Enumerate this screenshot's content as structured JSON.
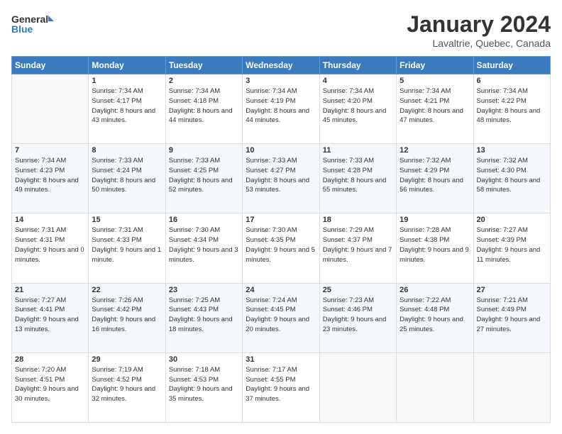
{
  "header": {
    "logo_line1": "General",
    "logo_line2": "Blue",
    "title": "January 2024",
    "subtitle": "Lavaltrie, Quebec, Canada"
  },
  "days_of_week": [
    "Sunday",
    "Monday",
    "Tuesday",
    "Wednesday",
    "Thursday",
    "Friday",
    "Saturday"
  ],
  "weeks": [
    [
      {
        "day": "",
        "sunrise": "",
        "sunset": "",
        "daylight": ""
      },
      {
        "day": "1",
        "sunrise": "Sunrise: 7:34 AM",
        "sunset": "Sunset: 4:17 PM",
        "daylight": "Daylight: 8 hours and 43 minutes."
      },
      {
        "day": "2",
        "sunrise": "Sunrise: 7:34 AM",
        "sunset": "Sunset: 4:18 PM",
        "daylight": "Daylight: 8 hours and 44 minutes."
      },
      {
        "day": "3",
        "sunrise": "Sunrise: 7:34 AM",
        "sunset": "Sunset: 4:19 PM",
        "daylight": "Daylight: 8 hours and 44 minutes."
      },
      {
        "day": "4",
        "sunrise": "Sunrise: 7:34 AM",
        "sunset": "Sunset: 4:20 PM",
        "daylight": "Daylight: 8 hours and 45 minutes."
      },
      {
        "day": "5",
        "sunrise": "Sunrise: 7:34 AM",
        "sunset": "Sunset: 4:21 PM",
        "daylight": "Daylight: 8 hours and 47 minutes."
      },
      {
        "day": "6",
        "sunrise": "Sunrise: 7:34 AM",
        "sunset": "Sunset: 4:22 PM",
        "daylight": "Daylight: 8 hours and 48 minutes."
      }
    ],
    [
      {
        "day": "7",
        "sunrise": "Sunrise: 7:34 AM",
        "sunset": "Sunset: 4:23 PM",
        "daylight": "Daylight: 8 hours and 49 minutes."
      },
      {
        "day": "8",
        "sunrise": "Sunrise: 7:33 AM",
        "sunset": "Sunset: 4:24 PM",
        "daylight": "Daylight: 8 hours and 50 minutes."
      },
      {
        "day": "9",
        "sunrise": "Sunrise: 7:33 AM",
        "sunset": "Sunset: 4:25 PM",
        "daylight": "Daylight: 8 hours and 52 minutes."
      },
      {
        "day": "10",
        "sunrise": "Sunrise: 7:33 AM",
        "sunset": "Sunset: 4:27 PM",
        "daylight": "Daylight: 8 hours and 53 minutes."
      },
      {
        "day": "11",
        "sunrise": "Sunrise: 7:33 AM",
        "sunset": "Sunset: 4:28 PM",
        "daylight": "Daylight: 8 hours and 55 minutes."
      },
      {
        "day": "12",
        "sunrise": "Sunrise: 7:32 AM",
        "sunset": "Sunset: 4:29 PM",
        "daylight": "Daylight: 8 hours and 56 minutes."
      },
      {
        "day": "13",
        "sunrise": "Sunrise: 7:32 AM",
        "sunset": "Sunset: 4:30 PM",
        "daylight": "Daylight: 8 hours and 58 minutes."
      }
    ],
    [
      {
        "day": "14",
        "sunrise": "Sunrise: 7:31 AM",
        "sunset": "Sunset: 4:31 PM",
        "daylight": "Daylight: 9 hours and 0 minutes."
      },
      {
        "day": "15",
        "sunrise": "Sunrise: 7:31 AM",
        "sunset": "Sunset: 4:33 PM",
        "daylight": "Daylight: 9 hours and 1 minute."
      },
      {
        "day": "16",
        "sunrise": "Sunrise: 7:30 AM",
        "sunset": "Sunset: 4:34 PM",
        "daylight": "Daylight: 9 hours and 3 minutes."
      },
      {
        "day": "17",
        "sunrise": "Sunrise: 7:30 AM",
        "sunset": "Sunset: 4:35 PM",
        "daylight": "Daylight: 9 hours and 5 minutes."
      },
      {
        "day": "18",
        "sunrise": "Sunrise: 7:29 AM",
        "sunset": "Sunset: 4:37 PM",
        "daylight": "Daylight: 9 hours and 7 minutes."
      },
      {
        "day": "19",
        "sunrise": "Sunrise: 7:28 AM",
        "sunset": "Sunset: 4:38 PM",
        "daylight": "Daylight: 9 hours and 9 minutes."
      },
      {
        "day": "20",
        "sunrise": "Sunrise: 7:27 AM",
        "sunset": "Sunset: 4:39 PM",
        "daylight": "Daylight: 9 hours and 11 minutes."
      }
    ],
    [
      {
        "day": "21",
        "sunrise": "Sunrise: 7:27 AM",
        "sunset": "Sunset: 4:41 PM",
        "daylight": "Daylight: 9 hours and 13 minutes."
      },
      {
        "day": "22",
        "sunrise": "Sunrise: 7:26 AM",
        "sunset": "Sunset: 4:42 PM",
        "daylight": "Daylight: 9 hours and 16 minutes."
      },
      {
        "day": "23",
        "sunrise": "Sunrise: 7:25 AM",
        "sunset": "Sunset: 4:43 PM",
        "daylight": "Daylight: 9 hours and 18 minutes."
      },
      {
        "day": "24",
        "sunrise": "Sunrise: 7:24 AM",
        "sunset": "Sunset: 4:45 PM",
        "daylight": "Daylight: 9 hours and 20 minutes."
      },
      {
        "day": "25",
        "sunrise": "Sunrise: 7:23 AM",
        "sunset": "Sunset: 4:46 PM",
        "daylight": "Daylight: 9 hours and 23 minutes."
      },
      {
        "day": "26",
        "sunrise": "Sunrise: 7:22 AM",
        "sunset": "Sunset: 4:48 PM",
        "daylight": "Daylight: 9 hours and 25 minutes."
      },
      {
        "day": "27",
        "sunrise": "Sunrise: 7:21 AM",
        "sunset": "Sunset: 4:49 PM",
        "daylight": "Daylight: 9 hours and 27 minutes."
      }
    ],
    [
      {
        "day": "28",
        "sunrise": "Sunrise: 7:20 AM",
        "sunset": "Sunset: 4:51 PM",
        "daylight": "Daylight: 9 hours and 30 minutes."
      },
      {
        "day": "29",
        "sunrise": "Sunrise: 7:19 AM",
        "sunset": "Sunset: 4:52 PM",
        "daylight": "Daylight: 9 hours and 32 minutes."
      },
      {
        "day": "30",
        "sunrise": "Sunrise: 7:18 AM",
        "sunset": "Sunset: 4:53 PM",
        "daylight": "Daylight: 9 hours and 35 minutes."
      },
      {
        "day": "31",
        "sunrise": "Sunrise: 7:17 AM",
        "sunset": "Sunset: 4:55 PM",
        "daylight": "Daylight: 9 hours and 37 minutes."
      },
      {
        "day": "",
        "sunrise": "",
        "sunset": "",
        "daylight": ""
      },
      {
        "day": "",
        "sunrise": "",
        "sunset": "",
        "daylight": ""
      },
      {
        "day": "",
        "sunrise": "",
        "sunset": "",
        "daylight": ""
      }
    ]
  ]
}
